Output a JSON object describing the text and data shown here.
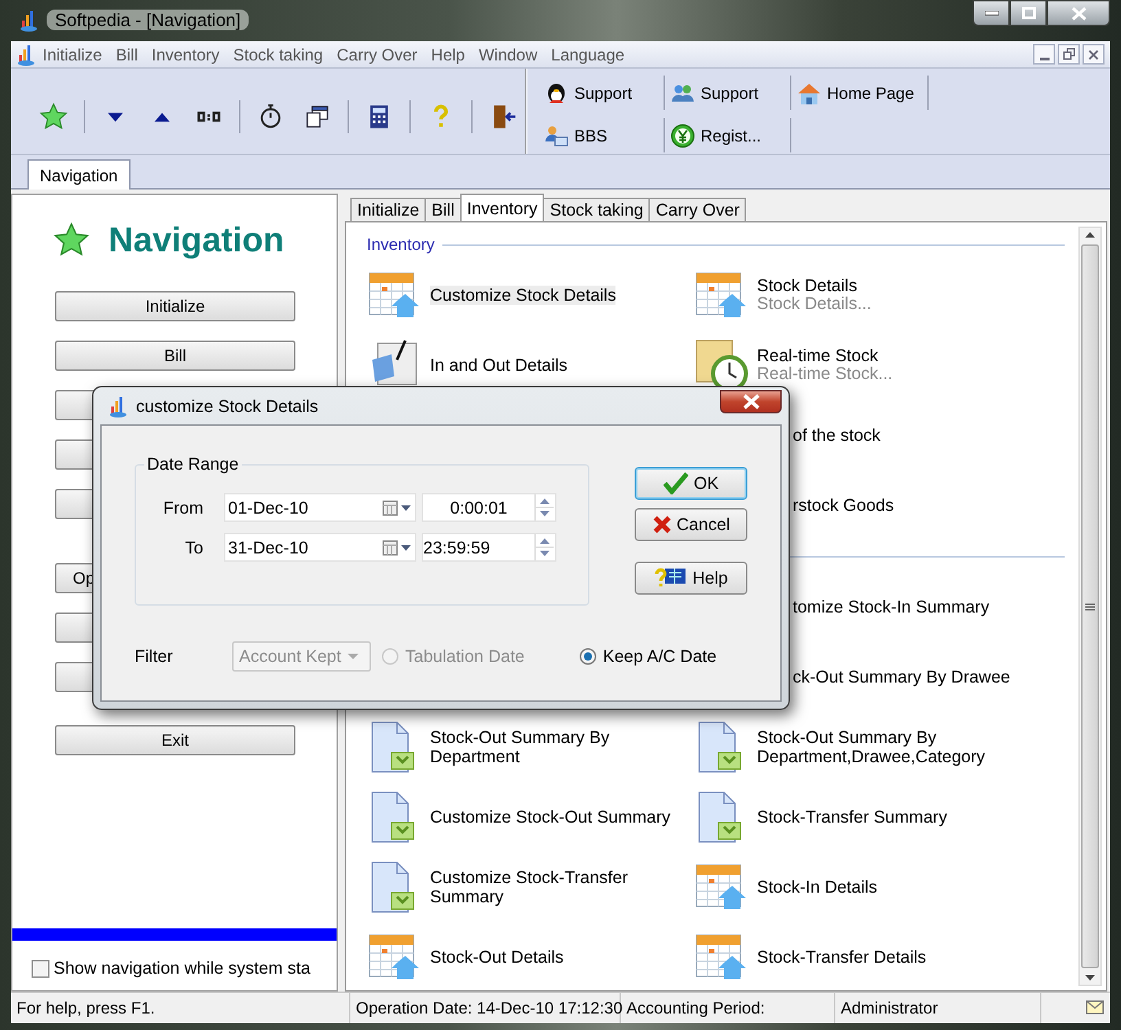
{
  "window": {
    "title": "Softpedia - [Navigation]"
  },
  "menu": [
    "Initialize",
    "Bill",
    "Inventory",
    "Stock taking",
    "Carry Over",
    "Help",
    "Window",
    "Language"
  ],
  "toolbar_links": [
    {
      "label": "Support"
    },
    {
      "label": "Support"
    },
    {
      "label": "Home Page"
    },
    {
      "label": "BBS"
    },
    {
      "label": "Regist..."
    }
  ],
  "doc_tabs": [
    {
      "label": "Navigation",
      "selected": true
    }
  ],
  "navigation": {
    "title": "Navigation",
    "groups": [
      [
        {
          "kind": "full",
          "label": "Initialize"
        },
        {
          "kind": "full",
          "label": "Bill"
        },
        {
          "kind": "covered"
        },
        {
          "kind": "covered"
        },
        {
          "kind": "covered"
        }
      ],
      [
        {
          "kind": "partial",
          "label": "Op"
        },
        {
          "kind": "covered"
        },
        {
          "kind": "covered"
        }
      ],
      [
        {
          "kind": "full",
          "label": "Exit"
        }
      ]
    ],
    "progress": {
      "level": 1
    },
    "show_on_start": {
      "label": "Show navigation while system sta",
      "checked": false
    }
  },
  "module_tabs": [
    {
      "label": "Initialize",
      "selected": false
    },
    {
      "label": "Bill",
      "selected": false
    },
    {
      "label": "Inventory",
      "selected": true
    },
    {
      "label": "Stock taking",
      "selected": false
    },
    {
      "label": "Carry Over",
      "selected": false
    }
  ],
  "sections": [
    {
      "title": "Inventory",
      "items": [
        {
          "kind": "full",
          "label": "Customize Stock Details",
          "selected": true
        },
        {
          "kind": "full",
          "label": "Stock Details",
          "subtitle": "Stock Details...",
          "selected": false
        },
        {
          "kind": "full",
          "label": "In and Out Details",
          "selected": false
        },
        {
          "kind": "full",
          "label": "Real-time Stock",
          "subtitle": "Real-time Stock...",
          "selected": false
        },
        {
          "kind": "hidden"
        },
        {
          "kind": "covered",
          "label": "of the stock"
        },
        {
          "kind": "hidden"
        },
        {
          "kind": "covered",
          "label": "rstock Goods"
        }
      ]
    },
    {
      "items": [
        {
          "kind": "hidden"
        },
        {
          "kind": "covered",
          "label": "tomize Stock-In Summary"
        },
        {
          "kind": "hidden"
        },
        {
          "kind": "covered",
          "label": "ck-Out Summary By Drawee"
        },
        {
          "kind": "full",
          "label": "Stock-Out Summary By Department",
          "selected": false
        },
        {
          "kind": "full",
          "label": "Stock-Out Summary By Department,Drawee,Category",
          "selected": false
        },
        {
          "kind": "full",
          "label": "Customize Stock-Out Summary",
          "selected": false
        },
        {
          "kind": "full",
          "label": "Stock-Transfer Summary",
          "selected": false
        },
        {
          "kind": "full",
          "label": "Customize Stock-Transfer Summary",
          "selected": false
        },
        {
          "kind": "full",
          "label": "Stock-In Details",
          "selected": false
        },
        {
          "kind": "full",
          "label": "Stock-Out Details",
          "selected": false
        },
        {
          "kind": "full",
          "label": "Stock-Transfer Details",
          "selected": false
        }
      ]
    }
  ],
  "dialog": {
    "title": "customize Stock Details",
    "group_title": "Date Range",
    "rows": [
      {
        "label": "From",
        "date": "01-Dec-10",
        "time": "0:00:01"
      },
      {
        "label": "To",
        "date": "31-Dec-10",
        "time": "23:59:59"
      }
    ],
    "buttons": [
      {
        "label": "OK",
        "default": true
      },
      {
        "label": "Cancel",
        "default": false
      },
      {
        "label": "Help",
        "default": false
      }
    ],
    "filter": {
      "label": "Filter",
      "value": "Account Kept",
      "disabled": true
    },
    "radios": [
      {
        "label": "Tabulation Date",
        "selected": false,
        "disabled": true
      },
      {
        "label": "Keep A/C Date",
        "selected": true,
        "disabled": false
      }
    ]
  },
  "status_bar": [
    "For help, press F1.",
    "Operation Date: 14-Dec-10 17:12:30",
    "Accounting Period:",
    "Administrator"
  ]
}
